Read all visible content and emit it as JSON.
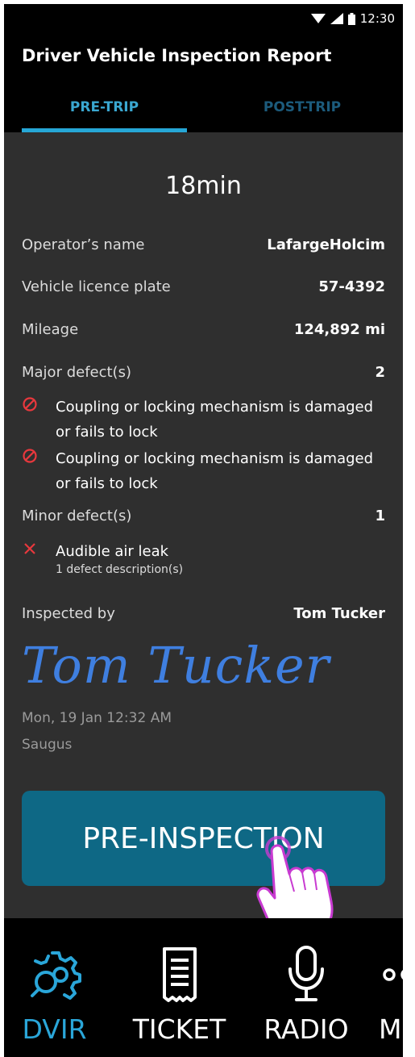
{
  "status_bar": {
    "time": "12:30",
    "icons": [
      "wifi-icon",
      "signal-icon",
      "battery-icon"
    ]
  },
  "header": {
    "title": "Driver Vehicle Inspection Report",
    "tabs": [
      {
        "label": "PRE-TRIP",
        "active": true
      },
      {
        "label": "POST-TRIP",
        "active": false
      }
    ]
  },
  "report": {
    "duration": "18min",
    "operator": {
      "label": "Operator’s name",
      "value": "LafargeHolcim"
    },
    "plate": {
      "label": "Vehicle licence plate",
      "value": "57-4392"
    },
    "mileage": {
      "label": "Mileage",
      "value": "124,892 mi"
    },
    "major": {
      "label": "Major defect(s)",
      "count": "2",
      "items": [
        {
          "text": "Coupling or locking mechanism is damaged or fails to lock",
          "icon": "prohibited-icon"
        },
        {
          "text": "Coupling or locking mechanism is damaged or fails to lock",
          "icon": "prohibited-icon"
        }
      ]
    },
    "minor": {
      "label": "Minor defect(s)",
      "count": "1",
      "items": [
        {
          "text": "Audible air leak",
          "sub": "1 defect description(s)",
          "icon": "close-icon"
        }
      ]
    },
    "inspected_by": {
      "label": "Inspected by",
      "value": "Tom Tucker"
    },
    "signature": "Tom Tucker",
    "datetime": "Mon, 19 Jan 12:32 AM",
    "location": "Saugus"
  },
  "action": {
    "label": "PRE-INSPECTION"
  },
  "bottom_nav": {
    "items": [
      {
        "label": "DVIR",
        "icon": "gear-search-icon",
        "active": true
      },
      {
        "label": "TICKET",
        "icon": "receipt-icon",
        "active": false
      },
      {
        "label": "RADIO",
        "icon": "microphone-icon",
        "active": false
      },
      {
        "label": "MC",
        "icon": "more-icon",
        "active": false
      }
    ]
  },
  "colors": {
    "accent": "#26a7d6",
    "button": "#0e6885",
    "defect_red": "#e8383d",
    "background": "#2f2f2f"
  }
}
